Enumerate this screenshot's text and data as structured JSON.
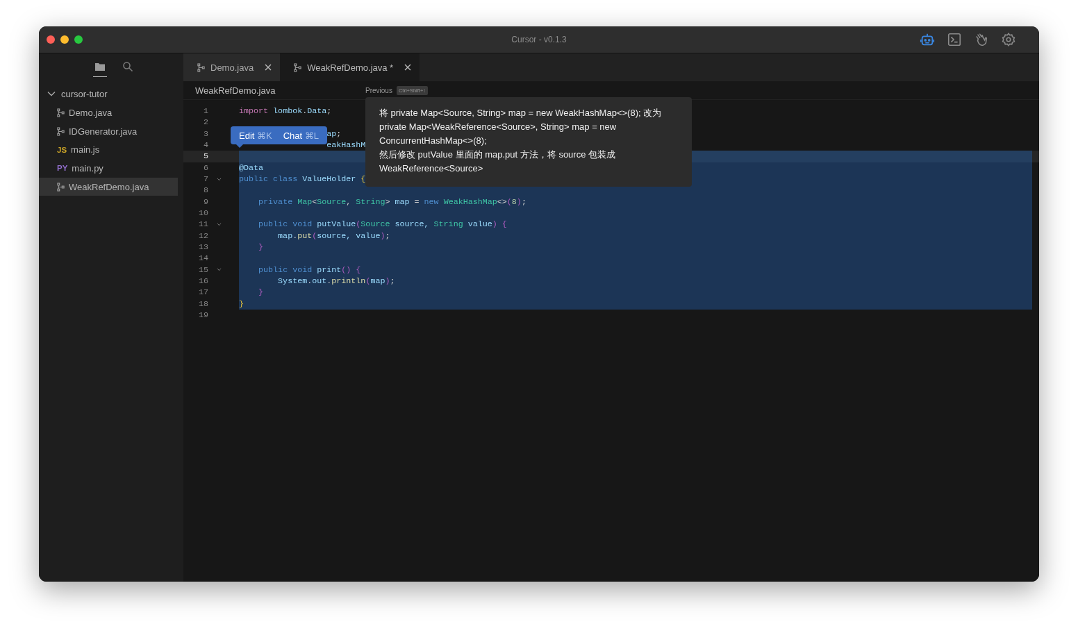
{
  "window": {
    "title": "Cursor - v0.1.3"
  },
  "toolbar": [
    {
      "kind": "robot",
      "selected": true
    },
    {
      "kind": "terminal",
      "selected": false
    },
    {
      "kind": "hand",
      "selected": false
    },
    {
      "kind": "gear",
      "selected": false
    }
  ],
  "sidebar": {
    "views": [
      {
        "kind": "files",
        "selected": true
      },
      {
        "kind": "search",
        "selected": false
      }
    ],
    "folder": {
      "label": "cursor-tutor",
      "expanded": true,
      "children": [
        {
          "label": "Demo.java",
          "kind": "java",
          "selected": false
        },
        {
          "label": "IDGenerator.java",
          "kind": "java",
          "selected": false
        },
        {
          "label": "main.js",
          "kind": "badge",
          "badge": "JS",
          "color": "#c9a227",
          "selected": false
        },
        {
          "label": "main.py",
          "kind": "badge",
          "badge": "PY",
          "color": "#8f6cc9",
          "selected": false
        },
        {
          "label": "WeakRefDemo.java",
          "kind": "java",
          "selected": true
        }
      ]
    }
  },
  "tabs": [
    {
      "label": "Demo.java",
      "selected": false
    },
    {
      "label": "WeakRefDemo.java *",
      "selected": true
    }
  ],
  "breadcrumb": {
    "file": "WeakRefDemo.java",
    "previous": {
      "label": "Previous",
      "shortcut": "Ctrl+Shift+↑"
    }
  },
  "editor": {
    "lines": [
      {
        "number": "1",
        "selected": false,
        "current": false,
        "foldable": false,
        "tokens": [
          {
            "text": "import ",
            "kind": "keyword"
          },
          {
            "text": "lombok",
            "kind": "ident"
          },
          {
            "text": ".",
            "kind": "plain"
          },
          {
            "text": "Data",
            "kind": "ident"
          },
          {
            "text": ";",
            "kind": "plain"
          }
        ]
      },
      {
        "number": "2",
        "selected": false,
        "current": false,
        "foldable": false
      },
      {
        "number": "3",
        "selected": false,
        "current": false,
        "foldable": false,
        "tokens": [
          {
            "text": "                  ap",
            "kind": "ident"
          },
          {
            "text": ";",
            "kind": "plain"
          }
        ]
      },
      {
        "number": "4",
        "selected": false,
        "current": false,
        "foldable": false,
        "tokens": [
          {
            "text": "                  eakHashM",
            "kind": "ident"
          }
        ]
      },
      {
        "number": "5",
        "selected": true,
        "current": true,
        "foldable": false
      },
      {
        "number": "6",
        "selected": true,
        "current": false,
        "foldable": false,
        "tokens": [
          {
            "text": "@Data",
            "kind": "ident"
          }
        ]
      },
      {
        "number": "7",
        "selected": true,
        "current": false,
        "foldable": true,
        "tokens": [
          {
            "text": "public class ",
            "kind": "storage"
          },
          {
            "text": "ValueHolder ",
            "kind": "ident"
          },
          {
            "text": "{",
            "kind": "brace"
          }
        ]
      },
      {
        "number": "8",
        "selected": true,
        "current": false,
        "foldable": false
      },
      {
        "number": "9",
        "selected": true,
        "current": false,
        "foldable": false,
        "tokens": [
          {
            "text": "    private ",
            "kind": "storage"
          },
          {
            "text": "Map",
            "kind": "type"
          },
          {
            "text": "<",
            "kind": "plain"
          },
          {
            "text": "Source",
            "kind": "type"
          },
          {
            "text": ", ",
            "kind": "plain"
          },
          {
            "text": "String",
            "kind": "type"
          },
          {
            "text": "> ",
            "kind": "plain"
          },
          {
            "text": "map ",
            "kind": "ident"
          },
          {
            "text": "= ",
            "kind": "plain"
          },
          {
            "text": "new ",
            "kind": "storage"
          },
          {
            "text": "WeakHashMap",
            "kind": "type"
          },
          {
            "text": "<>",
            "kind": "plain"
          },
          {
            "text": "(",
            "kind": "paren"
          },
          {
            "text": "8",
            "kind": "number"
          },
          {
            "text": ")",
            "kind": "paren"
          },
          {
            "text": ";",
            "kind": "plain"
          }
        ]
      },
      {
        "number": "10",
        "selected": true,
        "current": false,
        "foldable": false
      },
      {
        "number": "11",
        "selected": true,
        "current": false,
        "foldable": true,
        "tokens": [
          {
            "text": "    public void ",
            "kind": "storage"
          },
          {
            "text": "putValue",
            "kind": "ident"
          },
          {
            "text": "(",
            "kind": "paren"
          },
          {
            "text": "Source ",
            "kind": "type"
          },
          {
            "text": "source, ",
            "kind": "ident"
          },
          {
            "text": "String ",
            "kind": "type"
          },
          {
            "text": "value",
            "kind": "ident"
          },
          {
            "text": ") {",
            "kind": "paren"
          }
        ]
      },
      {
        "number": "12",
        "selected": true,
        "current": false,
        "foldable": false,
        "tokens": [
          {
            "text": "        map",
            "kind": "ident"
          },
          {
            "text": ".",
            "kind": "plain"
          },
          {
            "text": "put",
            "kind": "function"
          },
          {
            "text": "(",
            "kind": "paren"
          },
          {
            "text": "source, value",
            "kind": "ident"
          },
          {
            "text": ")",
            "kind": "paren"
          },
          {
            "text": ";",
            "kind": "plain"
          }
        ]
      },
      {
        "number": "13",
        "selected": true,
        "current": false,
        "foldable": false,
        "tokens": [
          {
            "text": "    }",
            "kind": "paren"
          }
        ]
      },
      {
        "number": "14",
        "selected": true,
        "current": false,
        "foldable": false
      },
      {
        "number": "15",
        "selected": true,
        "current": false,
        "foldable": true,
        "tokens": [
          {
            "text": "    public void ",
            "kind": "storage"
          },
          {
            "text": "print",
            "kind": "ident"
          },
          {
            "text": "() {",
            "kind": "paren"
          }
        ]
      },
      {
        "number": "16",
        "selected": true,
        "current": false,
        "foldable": false,
        "tokens": [
          {
            "text": "        System",
            "kind": "ident"
          },
          {
            "text": ".",
            "kind": "plain"
          },
          {
            "text": "out",
            "kind": "ident"
          },
          {
            "text": ".",
            "kind": "plain"
          },
          {
            "text": "println",
            "kind": "function"
          },
          {
            "text": "(",
            "kind": "paren"
          },
          {
            "text": "map",
            "kind": "ident"
          },
          {
            "text": ")",
            "kind": "paren"
          },
          {
            "text": ";",
            "kind": "plain"
          }
        ]
      },
      {
        "number": "17",
        "selected": true,
        "current": false,
        "foldable": false,
        "tokens": [
          {
            "text": "    }",
            "kind": "paren"
          }
        ]
      },
      {
        "number": "18",
        "selected": true,
        "current": false,
        "foldable": false,
        "tokens": [
          {
            "text": "}",
            "kind": "brace"
          }
        ]
      },
      {
        "number": "19",
        "selected": false,
        "current": false,
        "foldable": false
      }
    ]
  },
  "selection_actions": [
    {
      "label": "Edit",
      "shortcut": "⌘K"
    },
    {
      "label": "Chat",
      "shortcut": "⌘L"
    }
  ],
  "prompt_popup": {
    "paragraphs": [
      "将 private Map<Source, String> map = new WeakHashMap<>(8); 改为 private Map<WeakReference<Source>, String> map = new ConcurrentHashMap<>(8);",
      "然后修改 putValue 里面的  map.put 方法，将 source 包装成 WeakReference<Source>"
    ]
  }
}
